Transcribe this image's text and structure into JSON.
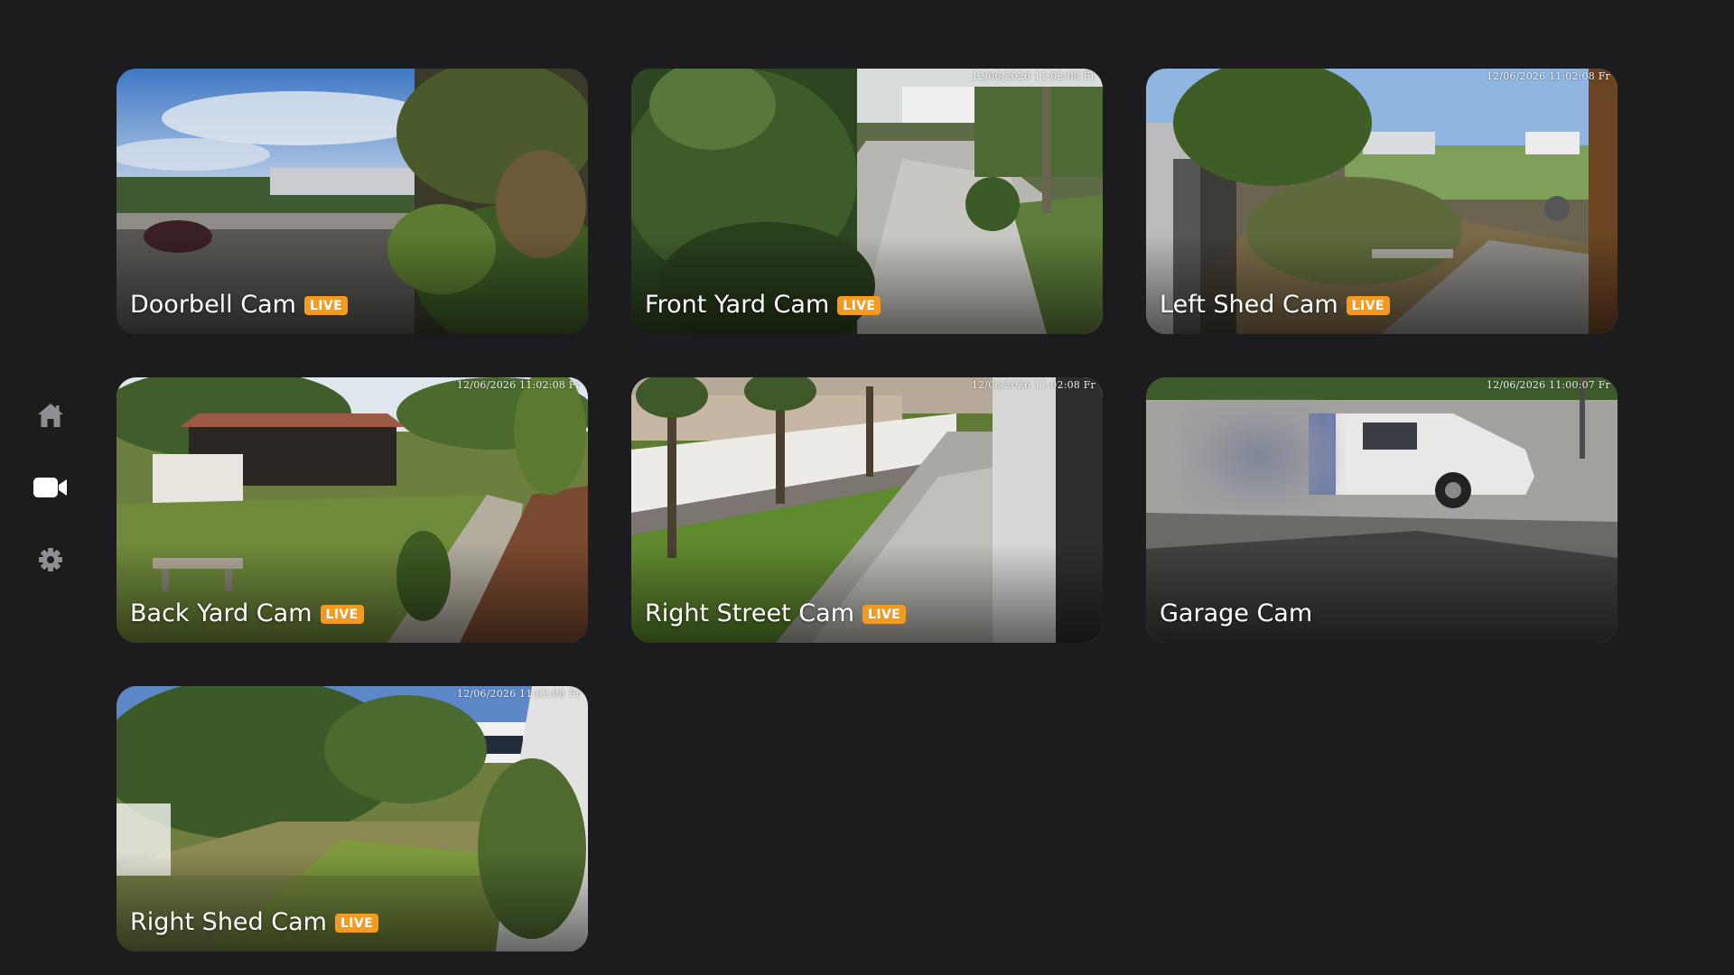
{
  "nav": {
    "items": [
      {
        "id": "home",
        "icon": "home-icon",
        "active": false,
        "color": "#8e8e93"
      },
      {
        "id": "cameras",
        "icon": "video-camera-icon",
        "active": true,
        "color": "#ffffff"
      },
      {
        "id": "settings",
        "icon": "gear-icon",
        "active": false,
        "color": "#8e8e93"
      }
    ]
  },
  "colors": {
    "background": "#1c1c1e",
    "live_badge": "#f29a21"
  },
  "cameras": [
    {
      "name": "Doorbell Cam",
      "live": "LIVE",
      "timestamp": ""
    },
    {
      "name": "Front Yard Cam",
      "live": "LIVE",
      "timestamp": "12/06/2026 11:02:08 Fr"
    },
    {
      "name": "Left Shed Cam",
      "live": "LIVE",
      "timestamp": "12/06/2026 11:02:08 Fr"
    },
    {
      "name": "Back Yard Cam",
      "live": "LIVE",
      "timestamp": "12/06/2026 11:02:08 Fr"
    },
    {
      "name": "Right Street Cam",
      "live": "LIVE",
      "timestamp": "12/06/2026 11:02:08 Fr"
    },
    {
      "name": "Garage Cam",
      "live": "",
      "timestamp": "12/06/2026 11:00:07 Fr"
    },
    {
      "name": "Right Shed Cam",
      "live": "LIVE",
      "timestamp": "12/06/2026 11:02:08 Fr"
    }
  ]
}
